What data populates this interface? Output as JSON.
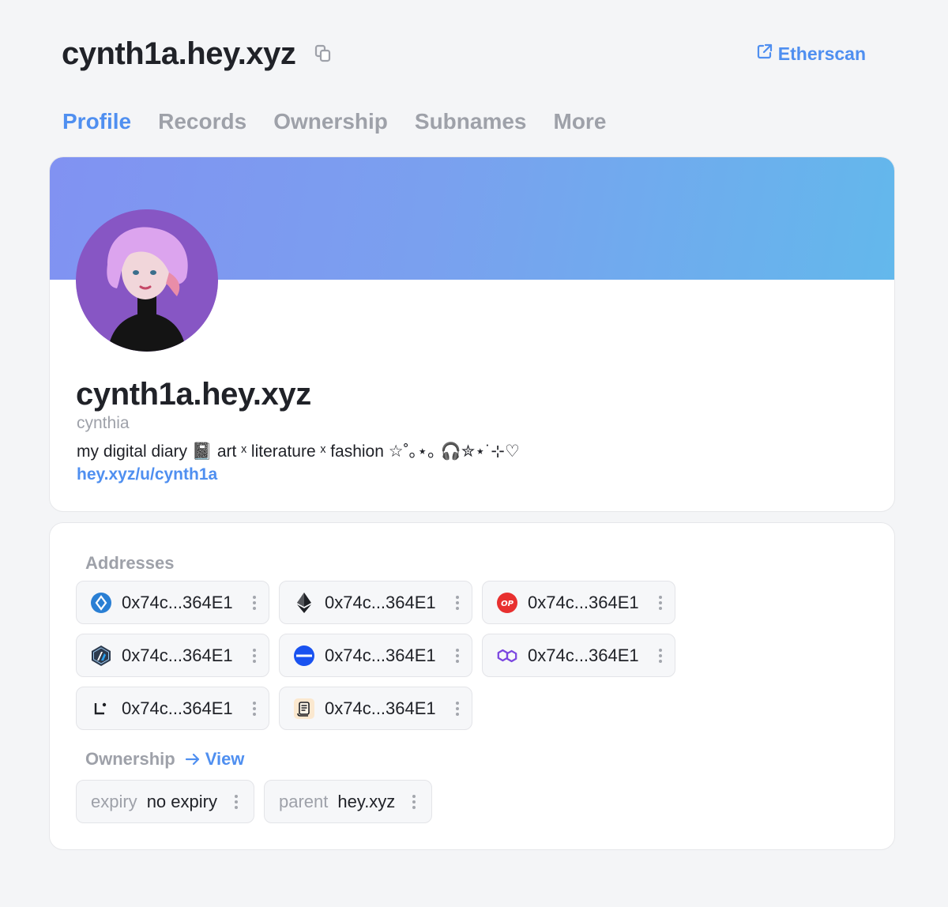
{
  "header": {
    "title": "cynth1a.hey.xyz",
    "etherscan_label": "Etherscan"
  },
  "tabs": [
    {
      "label": "Profile",
      "active": true
    },
    {
      "label": "Records",
      "active": false
    },
    {
      "label": "Ownership",
      "active": false
    },
    {
      "label": "Subnames",
      "active": false
    },
    {
      "label": "More",
      "active": false
    }
  ],
  "profile": {
    "name": "cynth1a.hey.xyz",
    "nickname": "cynthia",
    "bio": "my digital diary 📓 art ˣ literature ˣ fashion ☆˚｡⋆｡ 🎧✮⋆˙⊹♡",
    "link": "hey.xyz/u/cynth1a"
  },
  "addresses": {
    "label": "Addresses",
    "items": [
      {
        "icon": "btc-style-blue-icon",
        "value": "0x74c...364E1"
      },
      {
        "icon": "ethereum-icon",
        "value": "0x74c...364E1"
      },
      {
        "icon": "optimism-icon",
        "value": "0x74c...364E1"
      },
      {
        "icon": "arbitrum-icon",
        "value": "0x74c...364E1"
      },
      {
        "icon": "base-icon",
        "value": "0x74c...364E1"
      },
      {
        "icon": "polygon-icon",
        "value": "0x74c...364E1"
      },
      {
        "icon": "linea-icon",
        "value": "0x74c...364E1"
      },
      {
        "icon": "scroll-icon",
        "value": "0x74c...364E1"
      }
    ]
  },
  "ownership": {
    "label": "Ownership",
    "view_label": "View",
    "items": [
      {
        "key": "expiry",
        "value": "no expiry"
      },
      {
        "key": "parent",
        "value": "hey.xyz"
      }
    ]
  },
  "colors": {
    "accent": "#4f8ff0",
    "muted": "#9ea1a9",
    "text": "#202228",
    "banner_start": "#8192f2",
    "banner_end": "#63b8ec"
  }
}
